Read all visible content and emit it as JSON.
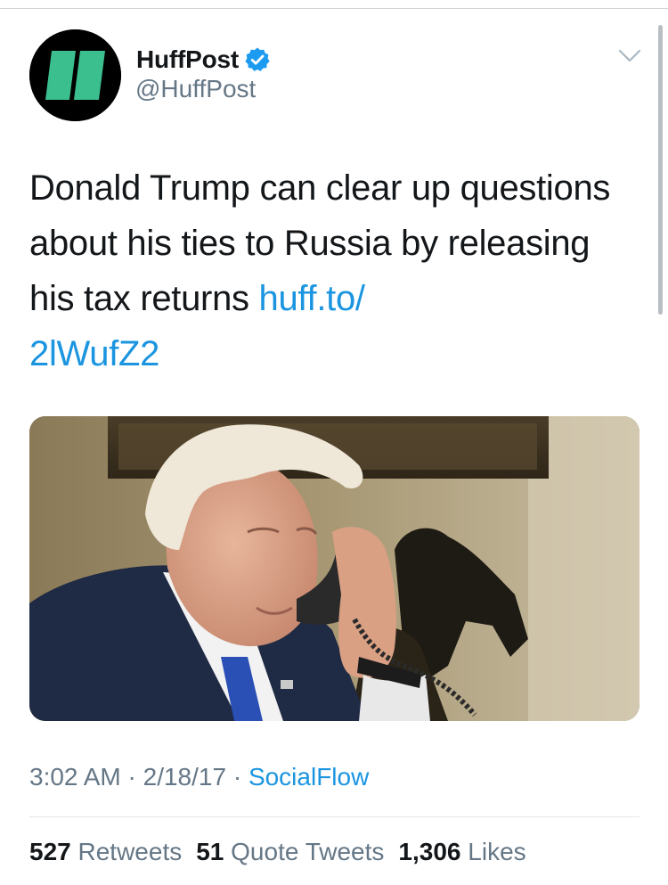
{
  "author": {
    "display_name": "HuffPost",
    "handle": "@HuffPost",
    "verified_icon": "verified-badge-icon",
    "avatar_icon": "huffpost-logo-icon",
    "avatar_colors": {
      "background": "#000000",
      "bars": "#3cbf8f"
    }
  },
  "menu": {
    "icon": "chevron-down-icon"
  },
  "tweet": {
    "text_before": "Donald Trump can clear up questions about his ties to Russia by releasing his tax returns ",
    "link_line1": "huff.to/",
    "link_line2": "2lWufZ2"
  },
  "media": {
    "image": "photo-man-on-telephone"
  },
  "meta": {
    "time": "3:02 AM",
    "separator": " · ",
    "date": "2/18/17",
    "source": "SocialFlow"
  },
  "stats": {
    "retweets_count": "527",
    "retweets_label": "Retweets",
    "quotes_count": "51",
    "quotes_label": "Quote Tweets",
    "likes_count": "1,306",
    "likes_label": "Likes"
  },
  "colors": {
    "link": "#1b95e0",
    "secondary_text": "#657786",
    "primary_text": "#14171a"
  }
}
